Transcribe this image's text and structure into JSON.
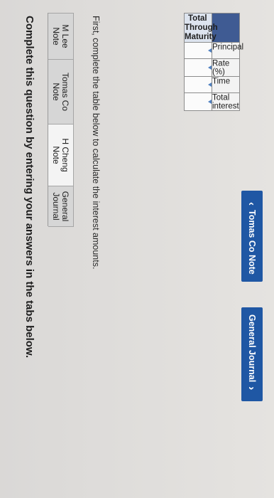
{
  "heading": "Complete this question by entering your answers in the tabs below.",
  "tabs": [
    {
      "label": "M Lee Note",
      "active": false
    },
    {
      "label": "Tomas Co Note",
      "active": false
    },
    {
      "label": "H Cheng Note",
      "active": true
    },
    {
      "label": "General Journal",
      "active": false
    }
  ],
  "instruction": "First, complete the table below to calculate the interest amounts.",
  "table": {
    "column_header": "Total Through Maturity",
    "rows": [
      {
        "label": "Principal",
        "value": ""
      },
      {
        "label": "Rate (%)",
        "value": ""
      },
      {
        "label": "Time",
        "value": ""
      },
      {
        "label": "Total interest",
        "value": ""
      }
    ]
  },
  "nav": {
    "prev_label": "Tomas Co Note",
    "next_label": "General Journal"
  },
  "colors": {
    "button": "#1f57a4",
    "table_header": "#3f5b93"
  },
  "icons": {
    "prev": "chevron-left-icon",
    "next": "chevron-right-icon"
  }
}
